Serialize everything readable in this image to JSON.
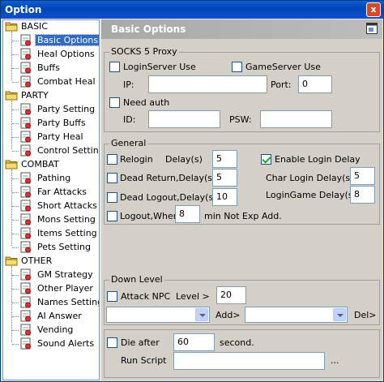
{
  "window": {
    "title": "Option",
    "close_glyph": "x"
  },
  "tree": {
    "categories": [
      {
        "label": "BASIC",
        "items": [
          "Basic Options",
          "Heal Options",
          "Buffs",
          "Combat Heal"
        ]
      },
      {
        "label": "PARTY",
        "items": [
          "Party Setting",
          "Party Buffs",
          "Party Heal",
          "Control Setting"
        ]
      },
      {
        "label": "COMBAT",
        "items": [
          "Pathing",
          "Far Attacks",
          "Short Attacks",
          "Mons Setting",
          "Items Setting",
          "Pets Setting"
        ]
      },
      {
        "label": "OTHER",
        "items": [
          "GM Strategy",
          "Other Player",
          "Names Setting",
          "AI Answer",
          "Vending",
          "Sound Alerts"
        ]
      }
    ],
    "selected": "Basic Options"
  },
  "header": {
    "title": "Basic Options",
    "icon": "window-icon"
  },
  "proxy": {
    "caption": "SOCKS 5 Proxy",
    "loginserver_label": "LoginServer Use",
    "loginserver_checked": false,
    "gameserver_label": "GameServer Use",
    "gameserver_checked": false,
    "ip_label": "IP:",
    "ip_value": "",
    "port_label": "Port:",
    "port_value": "0",
    "needauth_label": "Need auth",
    "needauth_checked": false,
    "id_label": "ID:",
    "id_value": "",
    "psw_label": "PSW:",
    "psw_value": ""
  },
  "general": {
    "caption": "General",
    "relogin_label": "Relogin",
    "relogin_checked": false,
    "relogin_delay_label": "Delay(s)",
    "relogin_delay": "5",
    "deadreturn_label": "Dead Return,Delay(s)",
    "deadreturn_checked": false,
    "deadreturn_delay": "5",
    "deadlogout_label": "Dead Logout,Delay(s)",
    "deadlogout_checked": false,
    "deadlogout_delay": "10",
    "logout_label": "Logout,When",
    "logout_checked": false,
    "logout_value": "8",
    "logout_suffix": "min Not Exp Add.",
    "enable_login_delay_label": "Enable Login Delay",
    "enable_login_delay_checked": true,
    "charlogin_label": "Char Login  Delay(s)",
    "charlogin_value": "5",
    "logingame_label": "LoginGame  Delay(s)",
    "logingame_value": "8"
  },
  "downlevel": {
    "caption": "Down Level",
    "attack_npc_label": "Attack NPC",
    "attack_npc_checked": false,
    "level_label": "Level  >",
    "level_value": "20",
    "dropdown1_value": "",
    "add_label": "Add>",
    "dropdown2_value": "",
    "del_label": "Del>"
  },
  "bottom": {
    "die_after_label": "Die after",
    "die_after_checked": false,
    "die_after_value": "60",
    "second_label": "second.",
    "run_script_label": "Run Script",
    "run_script_value": "",
    "browse_label": "..."
  },
  "colors": {
    "title_bar": "#0a4ed0",
    "selection": "#316ac5",
    "header": "#a8a8a8",
    "check_mark": "#21a121"
  }
}
